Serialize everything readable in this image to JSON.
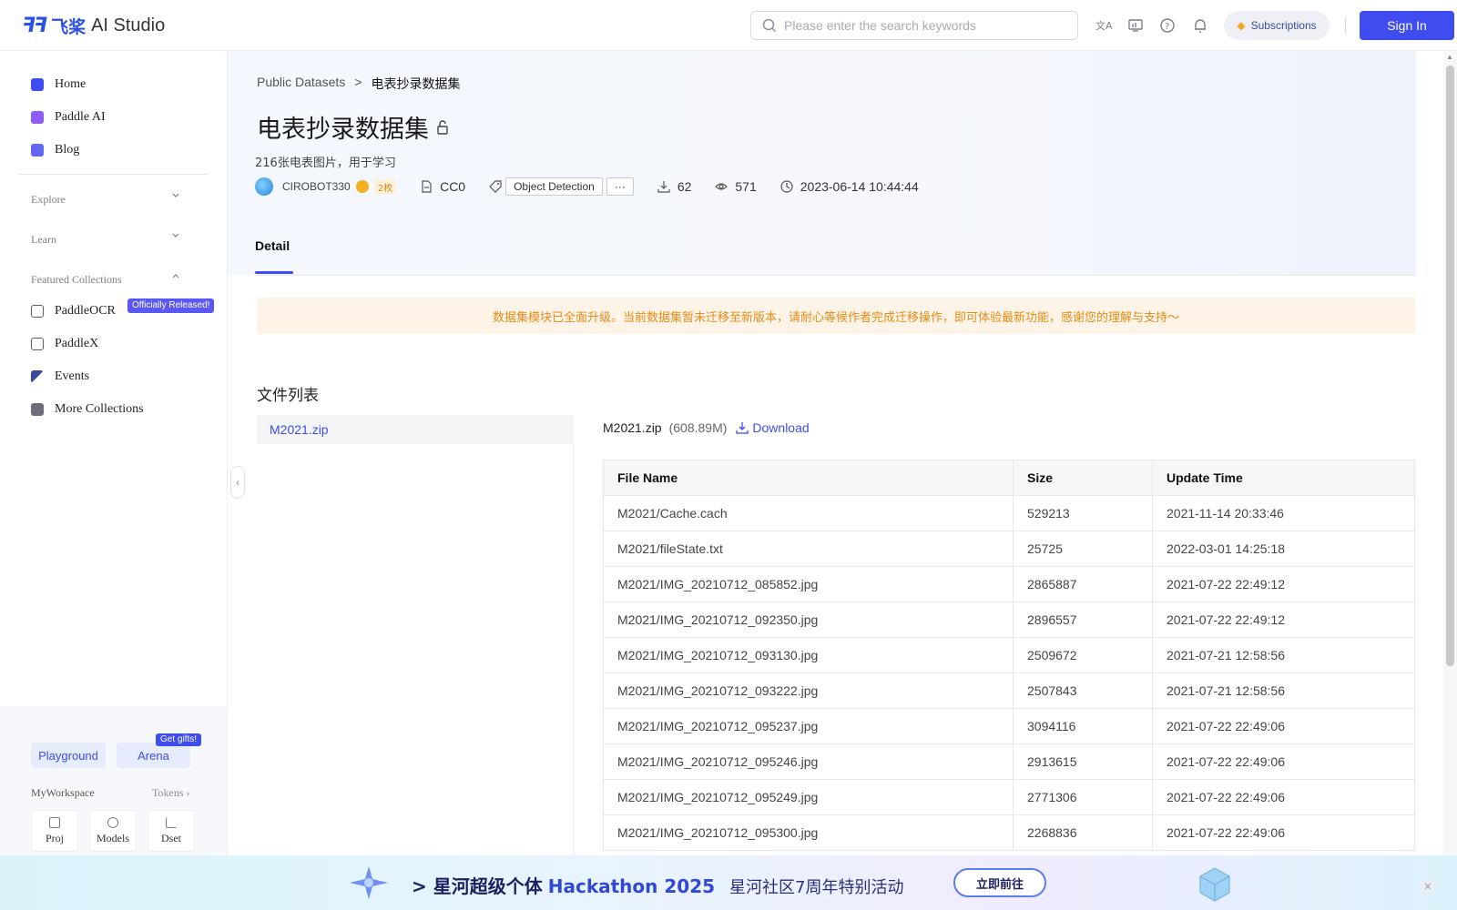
{
  "header": {
    "logo_mark": "ꟻꟻ",
    "logo_cn": "飞桨",
    "logo_en": "AI Studio",
    "search_placeholder": "Please enter the search keywords",
    "subscriptions_label": "Subscriptions",
    "signin_label": "Sign In",
    "accent_color": "#3e4cf0"
  },
  "sidebar": {
    "top_items": [
      {
        "label": "Home",
        "icon": "home-icon",
        "color": "#3e4cf0"
      },
      {
        "label": "Paddle AI",
        "icon": "paddle-ai-icon",
        "color": "#8b5cf6"
      },
      {
        "label": "Blog",
        "icon": "blog-icon",
        "color": "#6366f1"
      }
    ],
    "sections": [
      {
        "label": "Explore",
        "expanded": false
      },
      {
        "label": "Learn",
        "expanded": false
      },
      {
        "label": "Featured Collections",
        "expanded": true
      }
    ],
    "collections": [
      {
        "label": "PaddleOCR",
        "icon": "paddleocr-icon",
        "badge": "Officially Released!"
      },
      {
        "label": "PaddleX",
        "icon": "paddlex-icon"
      },
      {
        "label": "Events",
        "icon": "flag-icon"
      },
      {
        "label": "More Collections",
        "icon": "collection-icon"
      }
    ],
    "bottom": {
      "playground_label": "Playground",
      "arena_label": "Arena",
      "gifts_badge": "Get gifts!",
      "workspace_label": "MyWorkspace",
      "tokens_label": "Tokens",
      "cards": [
        "Proj",
        "Models",
        "Dset"
      ]
    }
  },
  "breadcrumb": {
    "parent": "Public Datasets",
    "separator": ">",
    "current": "电表抄录数据集"
  },
  "dataset": {
    "title": "电表抄录数据集",
    "description": "216张电表图片，用于学习",
    "author": "CIROBOT330",
    "medal": "2枚",
    "license": "CC0",
    "tag": "Object Detection",
    "tag_more": "···",
    "downloads": "62",
    "views": "571",
    "updated": "2023-06-14 10:44:44"
  },
  "tabs": [
    "Detail"
  ],
  "notice": "数据集模块已全面升级。当前数据集暂未迁移至新版本，请耐心等候作者完成迁移操作，即可体验最新功能，感谢您的理解与支持～",
  "file_list": {
    "title": "文件列表",
    "files": [
      "M2021.zip"
    ],
    "selected_name": "M2021.zip",
    "selected_size": "(608.89M)",
    "download_label": "Download",
    "columns": [
      "File Name",
      "Size",
      "Update Time"
    ],
    "rows": [
      [
        "M2021/Cache.cach",
        "529213",
        "2021-11-14 20:33:46"
      ],
      [
        "M2021/fileState.txt",
        "25725",
        "2022-03-01 14:25:18"
      ],
      [
        "M2021/IMG_20210712_085852.jpg",
        "2865887",
        "2021-07-22 22:49:12"
      ],
      [
        "M2021/IMG_20210712_092350.jpg",
        "2896557",
        "2021-07-22 22:49:12"
      ],
      [
        "M2021/IMG_20210712_093130.jpg",
        "2509672",
        "2021-07-21 12:58:56"
      ],
      [
        "M2021/IMG_20210712_093222.jpg",
        "2507843",
        "2021-07-21 12:58:56"
      ],
      [
        "M2021/IMG_20210712_095237.jpg",
        "3094116",
        "2021-07-22 22:49:06"
      ],
      [
        "M2021/IMG_20210712_095246.jpg",
        "2913615",
        "2021-07-22 22:49:06"
      ],
      [
        "M2021/IMG_20210712_095249.jpg",
        "2771306",
        "2021-07-22 22:49:06"
      ],
      [
        "M2021/IMG_20210712_095300.jpg",
        "2268836",
        "2021-07-22 22:49:06"
      ]
    ]
  },
  "banner": {
    "prefix": "> 星河超级个体",
    "highlight": "Hackathon 2025",
    "subtitle": "星河社区7周年特别活动",
    "button_label": "立即前往",
    "close_glyph": "✕"
  }
}
